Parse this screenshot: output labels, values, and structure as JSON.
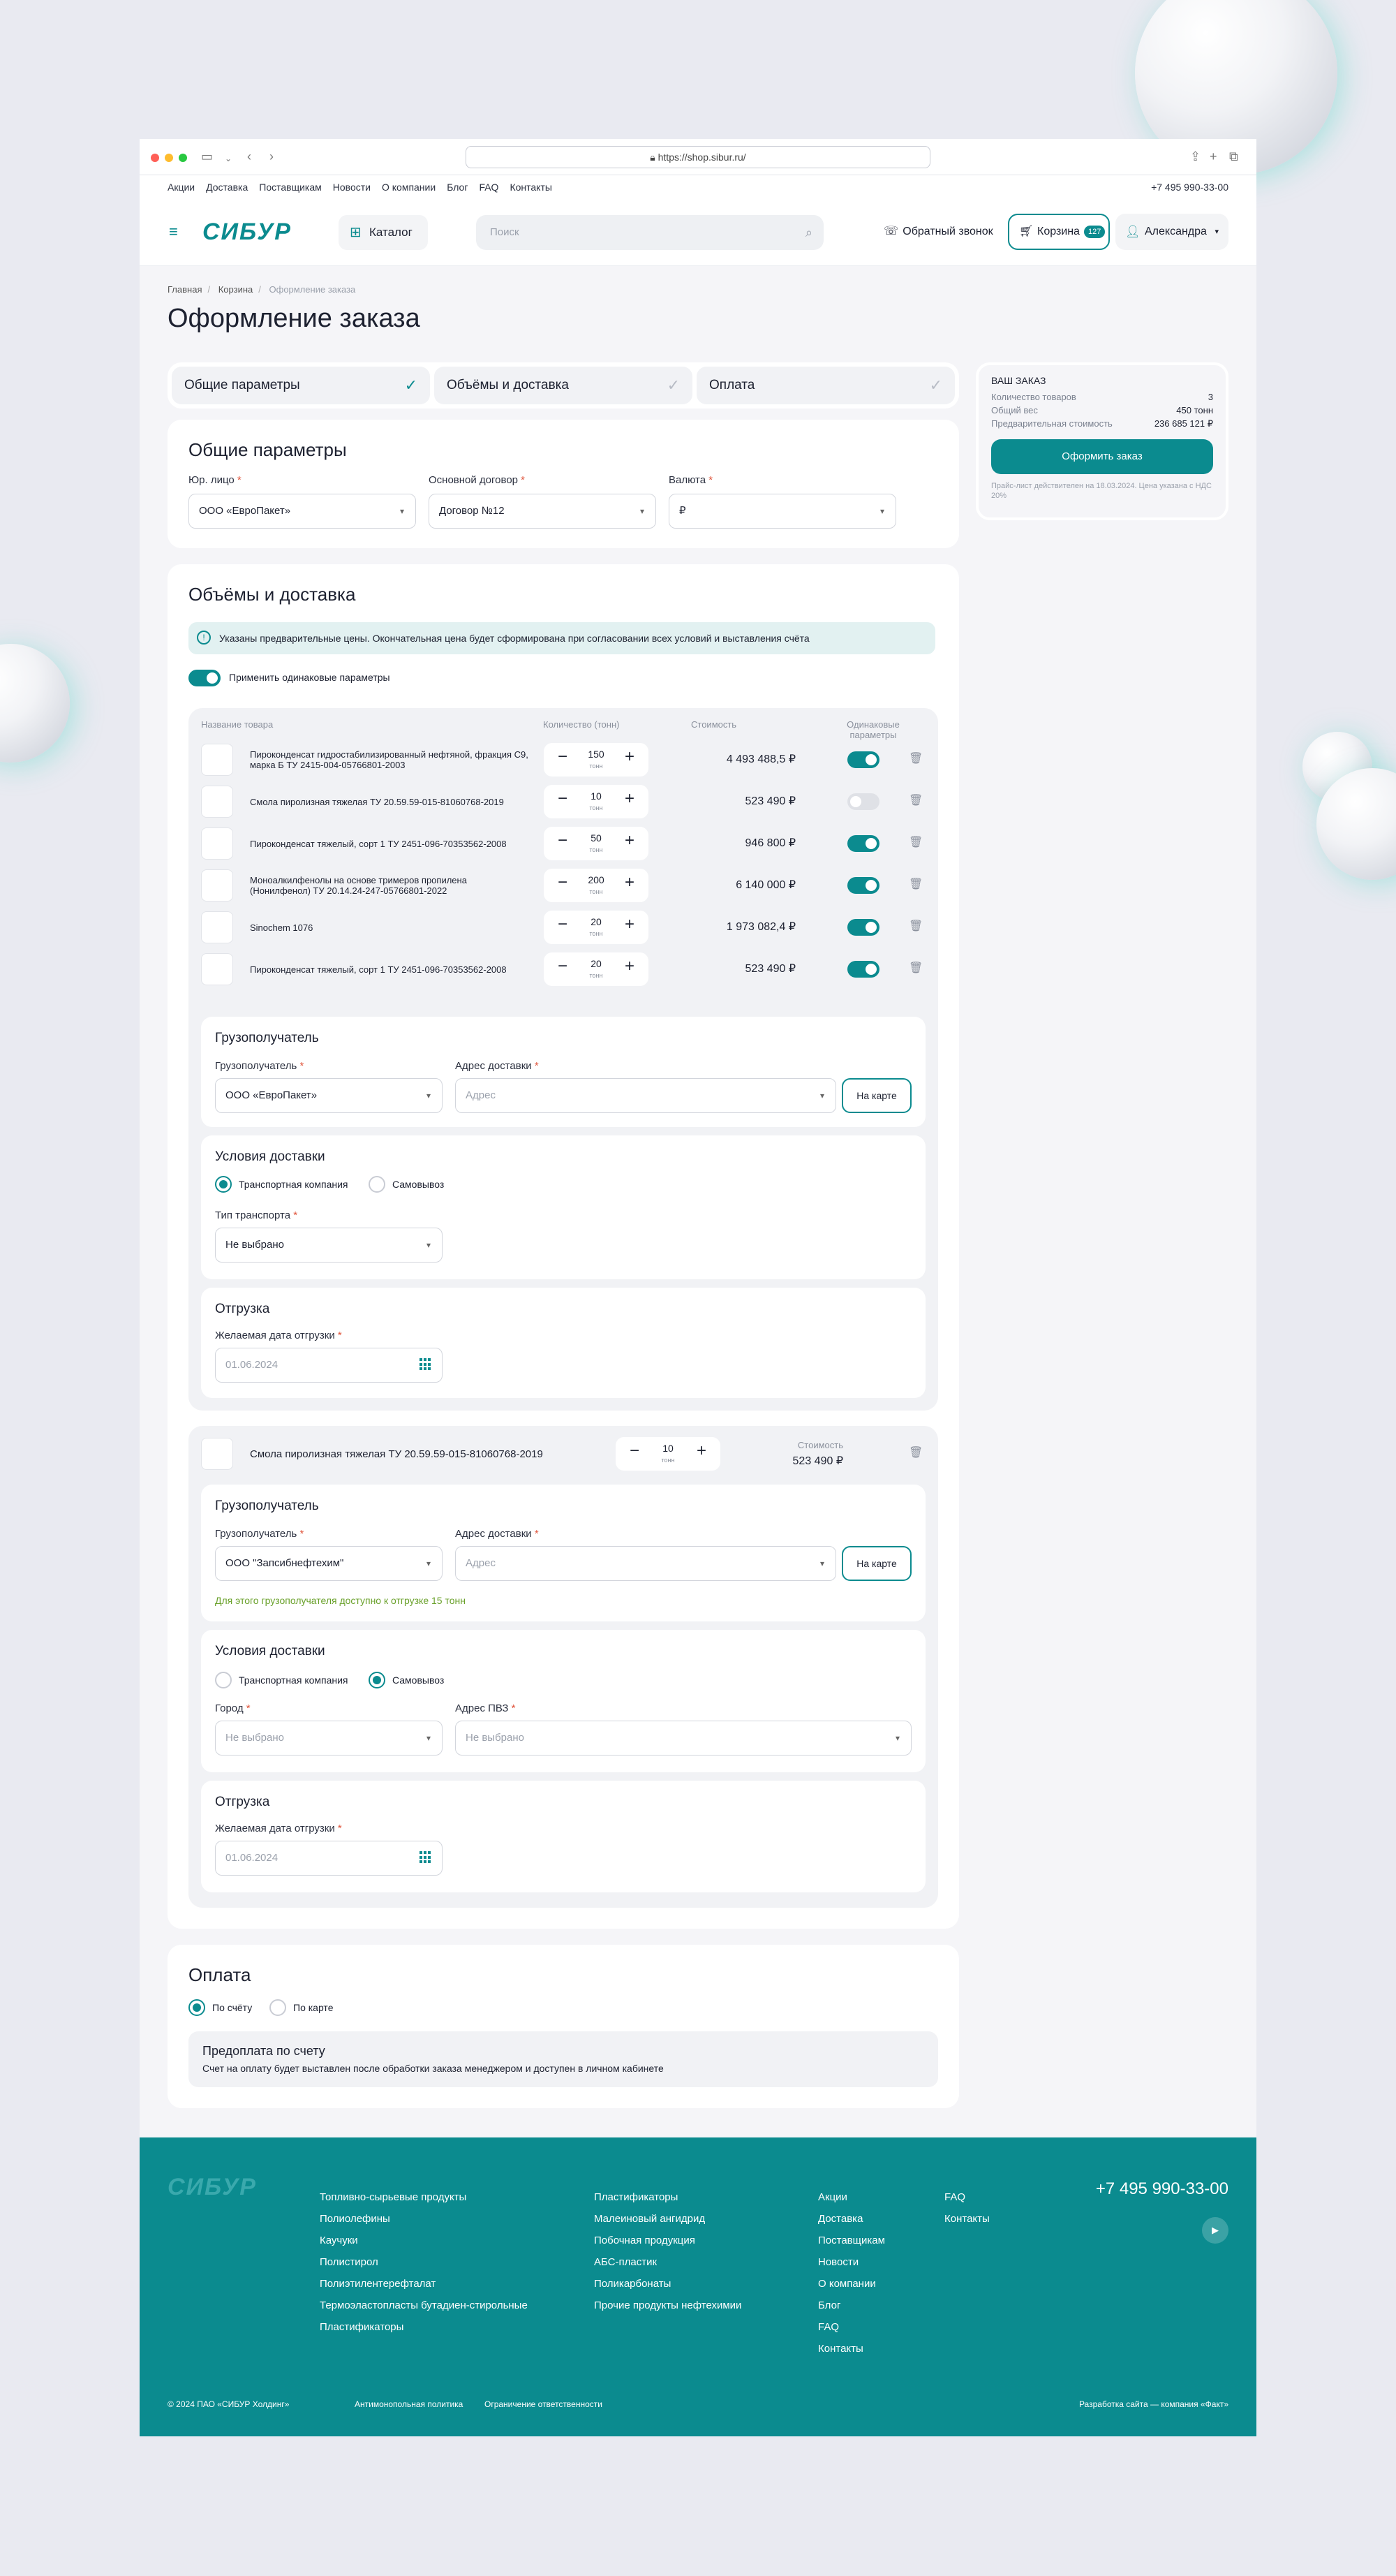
{
  "browser": {
    "url": "https://shop.sibur.ru/"
  },
  "topnav": {
    "links": [
      "Акции",
      "Доставка",
      "Поставщикам",
      "Новости",
      "О компании",
      "Блог",
      "FAQ",
      "Контакты"
    ],
    "phone": "+7 495 990-33-00"
  },
  "header": {
    "logo": "СИБУР",
    "catalog": "Каталог",
    "search_placeholder": "Поиск",
    "callback": "Обратный звонок",
    "cart_label": "Корзина",
    "cart_count": "127",
    "user": "Александра"
  },
  "breadcrumbs": [
    "Главная",
    "Корзина",
    "Оформление заказа"
  ],
  "page_title": "Оформление заказа",
  "steps": [
    "Общие параметры",
    "Объёмы и доставка",
    "Оплата"
  ],
  "summary": {
    "title": "ВАШ ЗАКАЗ",
    "rows": [
      {
        "label": "Количество товаров",
        "value": "3"
      },
      {
        "label": "Общий вес",
        "value": "450 тонн"
      },
      {
        "label": "Предварительная стоимость",
        "value": "236 685 121 ₽"
      }
    ],
    "button": "Оформить заказ",
    "note": "Прайс-лист действителен на 18.03.2024. Цена указана с НДС 20%"
  },
  "general": {
    "title": "Общие параметры",
    "fields": [
      {
        "label": "Юр. лицо",
        "value": "ООО «ЕвроПакет»"
      },
      {
        "label": "Основной договор",
        "value": "Договор №12"
      },
      {
        "label": "Валюта",
        "value": "₽"
      }
    ]
  },
  "volumes": {
    "title": "Объёмы и доставка",
    "notice": "Указаны предварительные цены. Окончательная цена будет сформирована при согласовании всех условий и выставления счёта",
    "same_params": "Применить одинаковые параметры",
    "columns": [
      "Название товара",
      "Количество (тонн)",
      "Стоимость",
      "Одинаковые параметры"
    ],
    "products": [
      {
        "name": "Пироконденсат гидростабилизированный нефтяной, фракция С9, марка Б ТУ 2415-004-05766801-2003",
        "qty": "150",
        "unit": "тонн",
        "price": "4 493 488,5 ₽",
        "same": true
      },
      {
        "name": "Смола пиролизная тяжелая ТУ 20.59.59-015-81060768-2019",
        "qty": "10",
        "unit": "тонн",
        "price": "523 490 ₽",
        "same": false
      },
      {
        "name": "Пироконденсат тяжелый, сорт 1 ТУ 2451-096-70353562-2008",
        "qty": "50",
        "unit": "тонн",
        "price": "946 800 ₽",
        "same": true
      },
      {
        "name": "Моноалкилфенолы на основе тримеров пропилена (Нонилфенол) ТУ 20.14.24-247-05766801-2022",
        "qty": "200",
        "unit": "тонн",
        "price": "6 140 000 ₽",
        "same": true
      },
      {
        "name": "Sinochem 1076",
        "qty": "20",
        "unit": "тонн",
        "price": "1 973 082,4 ₽",
        "same": true
      },
      {
        "name": "Пироконденсат тяжелый, сорт 1 ТУ 2451-096-70353562-2008",
        "qty": "20",
        "unit": "тонн",
        "price": "523 490 ₽",
        "same": true
      }
    ],
    "consignee": {
      "title": "Грузополучатель",
      "consignee_label": "Грузополучатель",
      "consignee_value": "ООО «ЕвроПакет»",
      "address_label": "Адрес доставки",
      "address_placeholder": "Адрес",
      "map_button": "На карте"
    },
    "delivery": {
      "title": "Условия доставки",
      "option_tc": "Транспортная компания",
      "option_pickup": "Самовывоз",
      "transport_label": "Тип транспорта",
      "transport_value": "Не выбрано"
    },
    "shipping": {
      "title": "Отгрузка",
      "date_label": "Желаемая дата отгрузки",
      "date_placeholder": "01.06.2024"
    },
    "separate": {
      "name": "Смола пиролизная тяжелая ТУ 20.59.59-015-81060768-2019",
      "qty": "10",
      "unit": "тонн",
      "price_label": "Стоимость",
      "price": "523 490 ₽",
      "consignee_title": "Грузополучатель",
      "consignee_label": "Грузополучатель",
      "consignee_value": "ООО \"Запсибнефтехим\"",
      "address_label": "Адрес доставки",
      "address_placeholder": "Адрес",
      "map_button": "На карте",
      "hint": "Для этого грузополучателя доступно к отгрузке 15 тонн",
      "delivery_title": "Условия доставки",
      "option_tc": "Транспортная компания",
      "option_pickup": "Самовывоз",
      "city_label": "Город",
      "city_value": "Не выбрано",
      "pvz_label": "Адрес ПВЗ",
      "pvz_value": "Не выбрано",
      "shipping_title": "Отгрузка",
      "date_label": "Желаемая дата отгрузки",
      "date_placeholder": "01.06.2024"
    }
  },
  "payment": {
    "title": "Оплата",
    "option_invoice": "По счёту",
    "option_card": "По карте",
    "prepay_title": "Предоплата по счету",
    "prepay_text": "Счет на оплату будет выставлен после обработки заказа  менеджером и доступен в личном кабинете"
  },
  "footer": {
    "logo": "СИБУР",
    "col1": [
      "Топливно-сырьевые продукты",
      "Полиолефины",
      "Каучуки",
      "Полистирол",
      "Полиэтилентерефталат",
      "Термоэластопласты бутадиен-стирольные",
      "Пластификаторы"
    ],
    "col2": [
      "Пластификаторы",
      "Малеиновый ангидрид",
      "Побочная продукция",
      "АБС-пластик",
      "Поликарбонаты",
      "Прочие продукты нефтехимии"
    ],
    "col3": [
      "Акции",
      "Доставка",
      "Поставщикам",
      "Новости",
      "О компании",
      "Блог",
      "FAQ",
      "Контакты"
    ],
    "col4": [
      "FAQ",
      "Контакты"
    ],
    "phone": "+7 495 990-33-00",
    "copyright": "© 2024 ПАО «СИБУР Холдинг»",
    "legal1": "Антимонопольная политика",
    "legal2": "Ограничение ответственности",
    "dev": "Разработка сайта — компания «Факт»"
  },
  "colors": {
    "accent": "#0b8b8f",
    "background": "#e9eaf1",
    "error": "#e0553c",
    "hint": "#6aa12b"
  }
}
